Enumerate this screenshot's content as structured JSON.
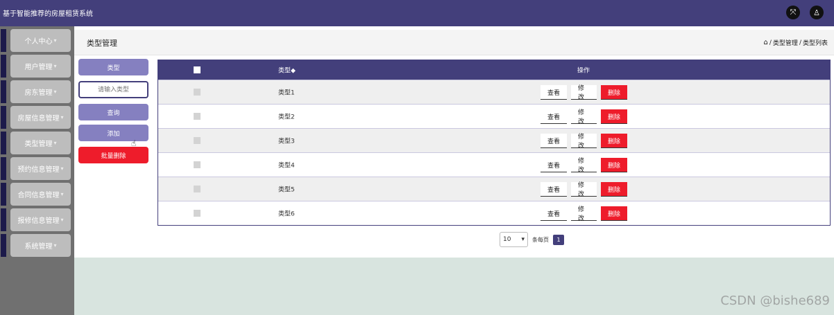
{
  "app": {
    "title": "基于智能推荐的房屋租赁系统"
  },
  "topbar": {
    "fullscreen_icon": "fullscreen-icon",
    "user_icon": "user-icon"
  },
  "sidebar": {
    "items": [
      {
        "label": "个人中心"
      },
      {
        "label": "用户管理"
      },
      {
        "label": "房东管理"
      },
      {
        "label": "房屋信息管理"
      },
      {
        "label": "类型管理"
      },
      {
        "label": "预约信息管理"
      },
      {
        "label": "合同信息管理"
      },
      {
        "label": "报修信息管理"
      },
      {
        "label": "系统管理"
      }
    ]
  },
  "header": {
    "title": "类型管理",
    "breadcrumb": {
      "part1": "类型管理",
      "sep": "/",
      "part2": "类型列表"
    }
  },
  "search": {
    "label": "类型",
    "placeholder": "请输入类型",
    "query_label": "查询",
    "add_label": "添加",
    "batch_delete_label": "批量删除"
  },
  "table": {
    "columns": {
      "type": "类型◆",
      "actions": "操作"
    },
    "rows": [
      {
        "type": "类型1"
      },
      {
        "type": "类型2"
      },
      {
        "type": "类型3"
      },
      {
        "type": "类型4"
      },
      {
        "type": "类型5"
      },
      {
        "type": "类型6"
      }
    ],
    "actions": {
      "view": "查看",
      "edit": "修改",
      "delete": "删除"
    }
  },
  "pagination": {
    "page_size": "10",
    "per_page_label": "条每页",
    "current_page": "1"
  },
  "watermark": "CSDN @bishe689",
  "colors": {
    "primary": "#433f7b",
    "danger": "#ee1c2b",
    "button": "#8580c0"
  }
}
